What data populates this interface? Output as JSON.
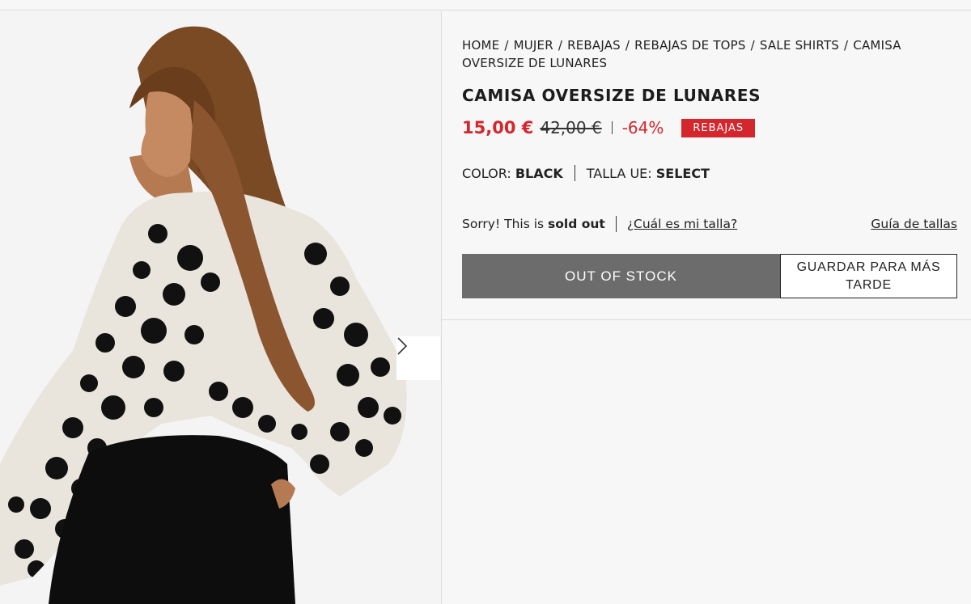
{
  "breadcrumb": {
    "items": [
      "HOME",
      "MUJER",
      "REBAJAS",
      "REBAJAS DE TOPS",
      "SALE SHIRTS",
      "CAMISA OVERSIZE DE LUNARES"
    ],
    "separator": "/"
  },
  "product": {
    "title": "CAMISA OVERSIZE DE LUNARES",
    "price_now": "15,00 €",
    "price_old": "42,00 €",
    "discount": "-64%",
    "badge": "REBAJAS"
  },
  "attributes": {
    "color_label": "COLOR:",
    "color_value": "BLACK",
    "size_label": "TALLA UE:",
    "size_value": "SELECT"
  },
  "stock": {
    "prefix": "Sorry! This is",
    "status": "sold out",
    "size_help_link": "¿Cuál es mi talla?",
    "size_guide_link": "Guía de tallas"
  },
  "actions": {
    "out_of_stock": "OUT OF STOCK",
    "save_for_later": "GUARDAR PARA MÁS TARDE"
  },
  "colors": {
    "sale_red": "#d3272d",
    "button_gray": "#6c6c6c"
  },
  "icons": {
    "next": "chevron-right-icon"
  }
}
